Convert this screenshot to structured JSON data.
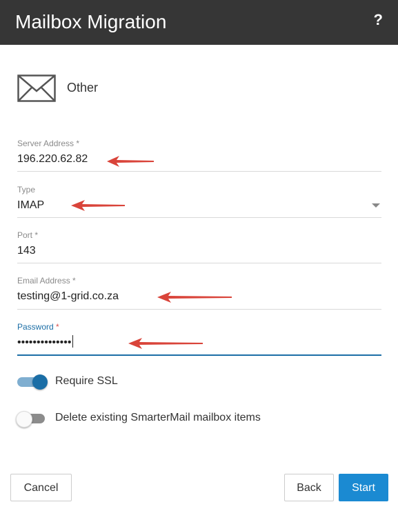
{
  "header": {
    "title": "Mailbox Migration",
    "help_label": "?"
  },
  "provider": {
    "icon": "envelope-icon",
    "label": "Other"
  },
  "fields": {
    "server_address": {
      "label": "Server Address",
      "required_mark": "*",
      "value": "196.220.62.82"
    },
    "type": {
      "label": "Type",
      "value": "IMAP"
    },
    "port": {
      "label": "Port",
      "required_mark": "*",
      "value": "143"
    },
    "email_address": {
      "label": "Email Address",
      "required_mark": "*",
      "value": "testing@1-grid.co.za"
    },
    "password": {
      "label": "Password",
      "required_mark": "*",
      "value": "••••••••••••••"
    }
  },
  "toggles": {
    "require_ssl": {
      "label": "Require SSL",
      "on": true
    },
    "delete_existing": {
      "label": "Delete existing SmarterMail mailbox items",
      "on": false
    }
  },
  "buttons": {
    "cancel": "Cancel",
    "back": "Back",
    "start": "Start"
  },
  "colors": {
    "header_bg": "#363636",
    "accent": "#1b6ea6",
    "primary_button": "#1b8ad2",
    "annotation_arrow": "#d9443a"
  }
}
